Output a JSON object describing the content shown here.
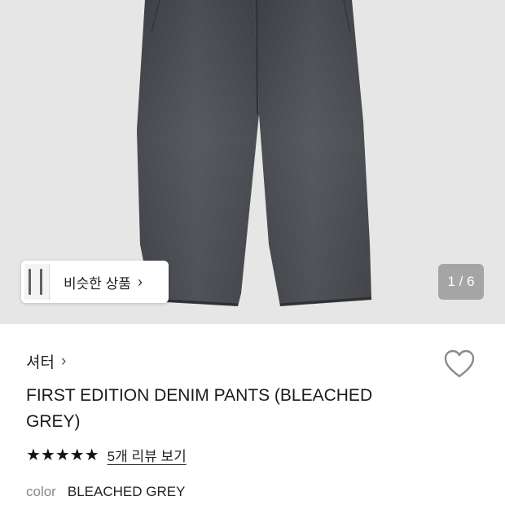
{
  "gallery": {
    "similar_label": "비슷한 상품",
    "similar_chevron": "›",
    "page_counter": "1 / 6",
    "background": "#e6e6e6",
    "denim_color": "#4a4c51"
  },
  "product": {
    "brand": "셔터",
    "brand_chevron": "›",
    "title": "FIRST EDITION DENIM PANTS (BLEACHED GREY)",
    "rating_stars": 5,
    "stars_text": "★★★★★",
    "reviews_link": "5개 리뷰 보기",
    "color_label": "color",
    "color_value": "BLEACHED GREY",
    "wishlist_icon": "heart-outline-icon"
  }
}
